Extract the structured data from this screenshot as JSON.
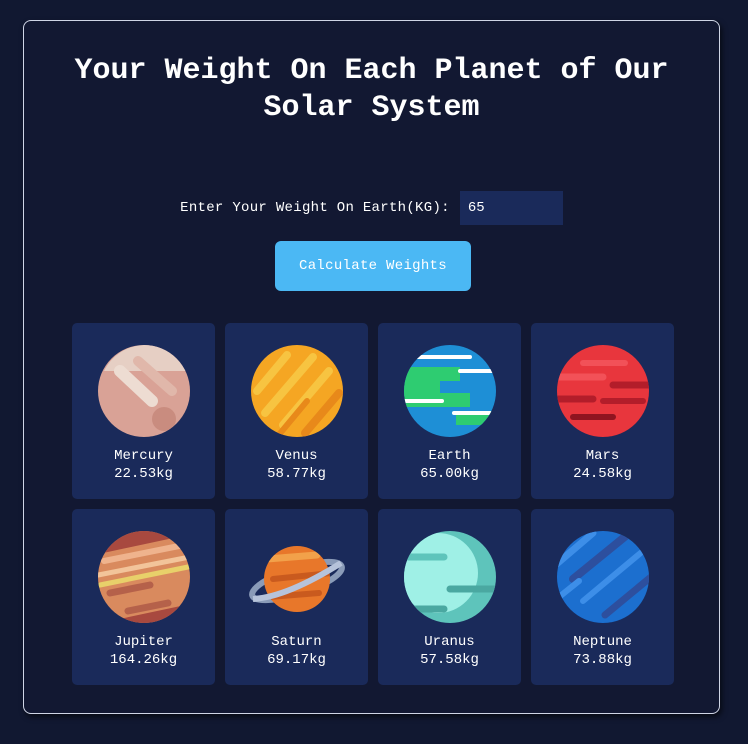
{
  "title": "Your Weight On Each Planet of Our Solar System",
  "input": {
    "label": "Enter Your Weight On Earth(KG):",
    "value": "65"
  },
  "button": {
    "label": "Calculate Weights"
  },
  "planets": [
    {
      "name": "Mercury",
      "weight": "22.53kg",
      "icon": "mercury-icon"
    },
    {
      "name": "Venus",
      "weight": "58.77kg",
      "icon": "venus-icon"
    },
    {
      "name": "Earth",
      "weight": "65.00kg",
      "icon": "earth-icon"
    },
    {
      "name": "Mars",
      "weight": "24.58kg",
      "icon": "mars-icon"
    },
    {
      "name": "Jupiter",
      "weight": "164.26kg",
      "icon": "jupiter-icon"
    },
    {
      "name": "Saturn",
      "weight": "69.17kg",
      "icon": "saturn-icon"
    },
    {
      "name": "Uranus",
      "weight": "57.58kg",
      "icon": "uranus-icon"
    },
    {
      "name": "Neptune",
      "weight": "73.88kg",
      "icon": "neptune-icon"
    }
  ],
  "colors": {
    "background": "#111831",
    "tile": "#1a2a5a",
    "button": "#4bb8f4",
    "border": "#cfd5e6"
  }
}
